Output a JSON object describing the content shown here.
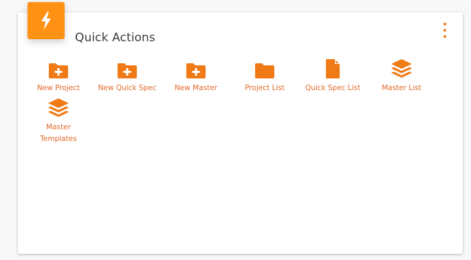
{
  "card": {
    "title": "Quick Actions",
    "header_icon": "bolt-icon",
    "menu_icon": "more-vertical-icon"
  },
  "colors": {
    "accent": "#f07a16",
    "badge": "#ff9114",
    "label": "#e0692a"
  },
  "actions": [
    {
      "label": "New Project",
      "icon": "folder-plus-icon"
    },
    {
      "label": "New Quick Spec",
      "icon": "folder-plus-icon"
    },
    {
      "label": "New Master",
      "icon": "folder-plus-icon"
    },
    {
      "label": "Project List",
      "icon": "folder-icon"
    },
    {
      "label": "Quick Spec List",
      "icon": "file-icon"
    },
    {
      "label": "Master List",
      "icon": "layers-icon"
    },
    {
      "label": "Master Templates",
      "icon": "layers-icon"
    }
  ]
}
